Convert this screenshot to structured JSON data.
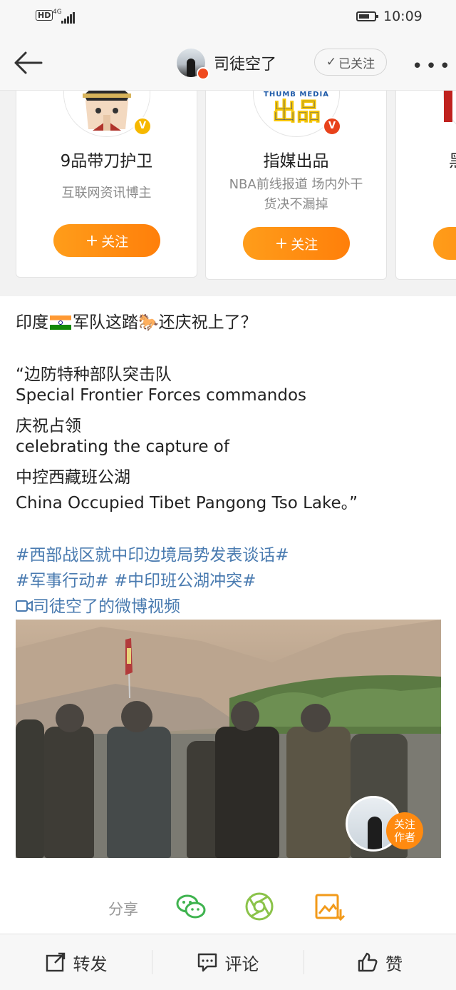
{
  "status_bar": {
    "hd": "HD",
    "network": "4G",
    "time": "10:09"
  },
  "nav": {
    "author_name": "司徒空了",
    "follow_state": "已关注",
    "more": "•••"
  },
  "recommend_cards": [
    {
      "name": "9品带刀护卫",
      "desc": "互联网资讯博主",
      "follow_label": "关注",
      "badge": "V"
    },
    {
      "name": "指媒出品",
      "desc_line1": "NBA前线报道 场内外干",
      "desc_line2": "货决不漏掉",
      "follow_label": "关注",
      "badge": "V",
      "logo_top": "THUMB MEDIA",
      "logo_main": "出品"
    },
    {
      "name": "黑"
    }
  ],
  "post": {
    "line1_prefix": "印度",
    "line1_mid": "军队这踏",
    "line1_suffix": "还庆祝上了？",
    "quote": [
      "“边防特种部队突击队",
      "Special Frontier Forces commandos",
      "庆祝占领",
      "celebrating the capture of",
      "中控西藏班公湖",
      "China Occupied Tibet Pangong Tso Lake。”"
    ],
    "tag1": "#西部战区就中印边境局势发表谈话#",
    "tag2": "#军事行动#",
    "tag3": "#中印班公湖冲突#",
    "video_link": "司徒空了的微博视频"
  },
  "video": {
    "follow_author_label": "关注作者"
  },
  "share": {
    "label": "分享",
    "icons": [
      "wechat-icon",
      "moments-icon",
      "save-image-icon"
    ]
  },
  "actions": {
    "repost": "转发",
    "comment": "评论",
    "like": "赞"
  },
  "colors": {
    "accent_orange": "#ff8a10",
    "link_blue": "#4a7bb0",
    "wechat_green": "#3fb34f"
  }
}
